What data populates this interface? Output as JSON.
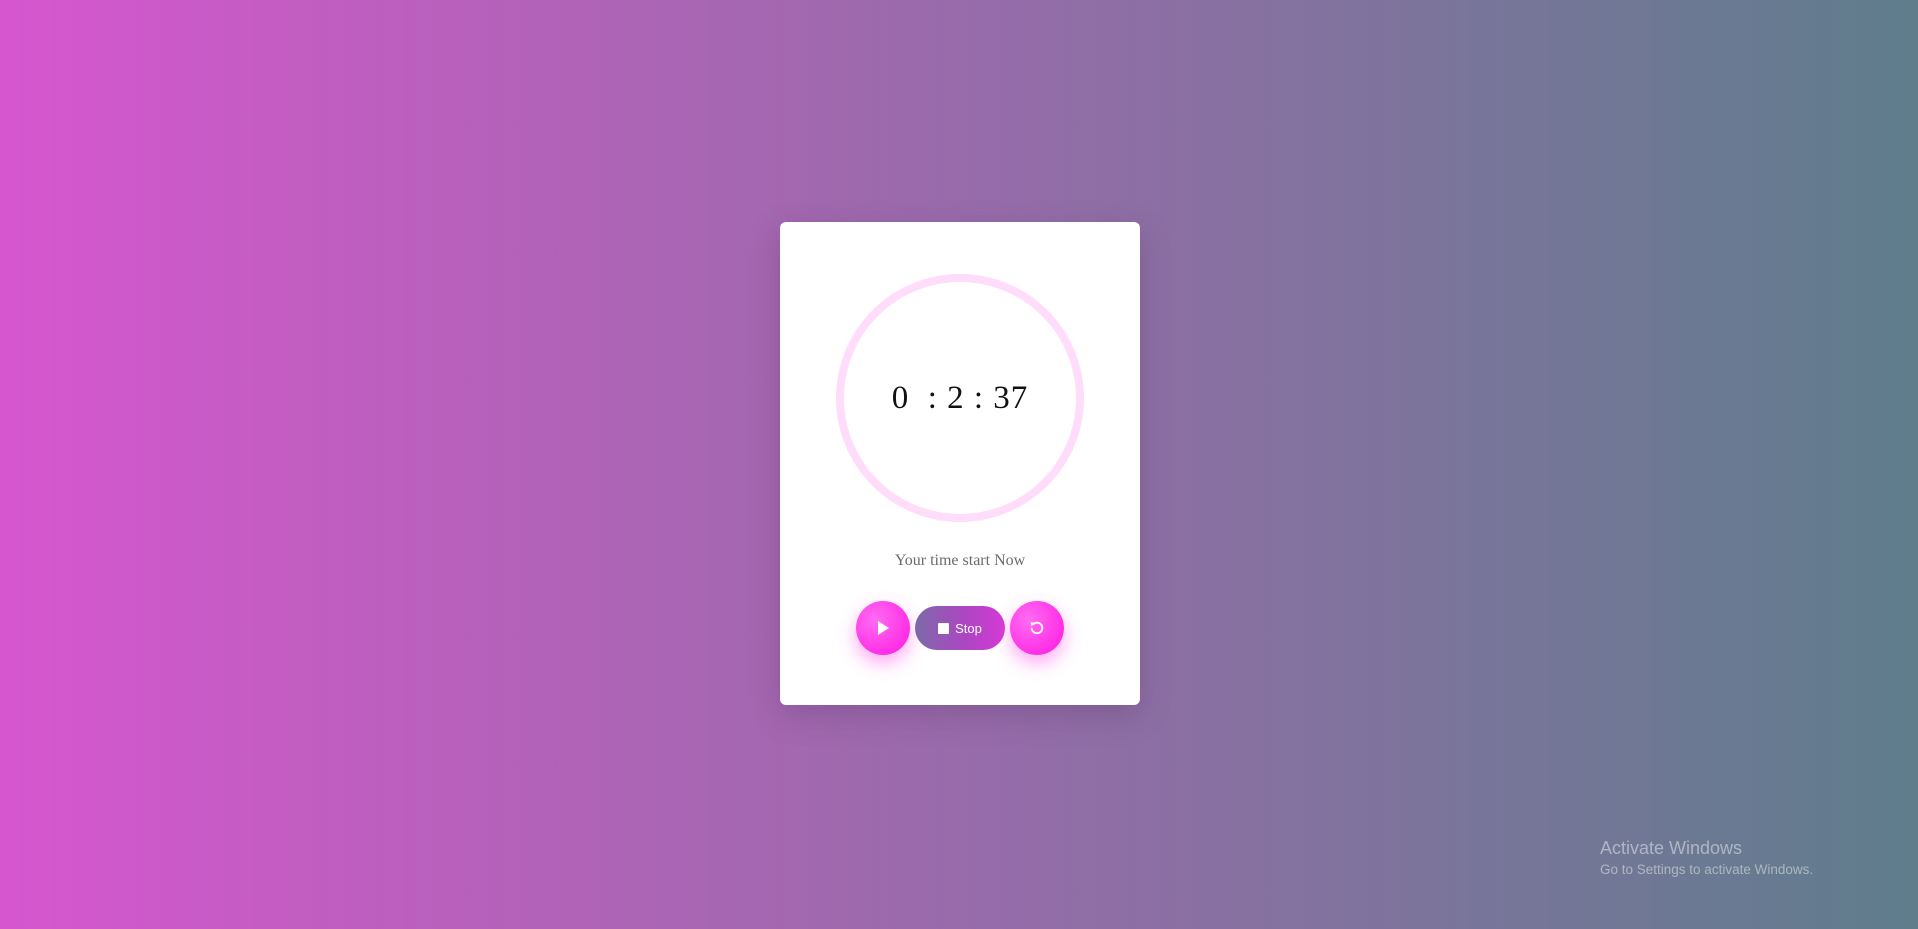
{
  "timer": {
    "display": "0  : 2 : 37",
    "caption": "Your time start Now"
  },
  "controls": {
    "play_icon": "play-icon",
    "stop_label": "Stop",
    "stop_icon": "stop-icon",
    "reset_icon": "reset-icon"
  },
  "colors": {
    "ring": "#ffdcfa",
    "accent": "#ff2fe6",
    "card": "#ffffff"
  },
  "watermark": {
    "title": "Activate Windows",
    "subtitle": "Go to Settings to activate Windows."
  }
}
